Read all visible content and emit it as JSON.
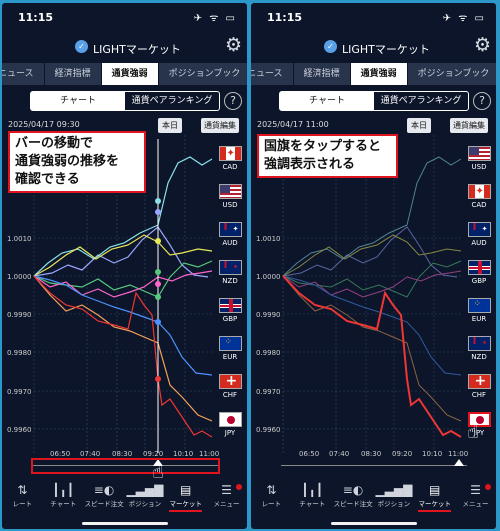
{
  "colors": {
    "usd": "#ff66cc",
    "cad": "#4c93ff",
    "aud": "#e9e75a",
    "nzd": "#58c97d",
    "gbp": "#8be0ea",
    "eur": "#9aa6ff",
    "chf": "#ef3636",
    "jpy": "#f4a259"
  },
  "left": {
    "status": {
      "time": "11:15",
      "icons": "✈ ᯤ ▭"
    },
    "header": {
      "title": "LIGHTマーケット"
    },
    "tabs": [
      "ニュース",
      "経済指標",
      "通貨強弱",
      "ポジションブック"
    ],
    "segment": [
      "チャート",
      "通貨ペアランキング"
    ],
    "help": "?",
    "datetime": "2025/04/17 09:30",
    "buttons": {
      "today": "本日",
      "edit": "通貨編集"
    },
    "annotation": [
      "バーの移動で",
      "通貨強弱の推移を",
      "確認できる"
    ],
    "flags": [
      "CAD",
      "USD",
      "AUD",
      "NZD",
      "GBP",
      "EUR",
      "CHF",
      "JPY"
    ],
    "yticks": [
      "1.0010",
      "1.0000",
      "0.9990",
      "0.9980",
      "0.9970",
      "0.9960"
    ],
    "xticks": [
      "06:50",
      "07:40",
      "08:30",
      "09:20",
      "10:10",
      "11:00"
    ]
  },
  "right": {
    "status": {
      "time": "11:15",
      "icons": "✈ ᯤ ▭"
    },
    "header": {
      "title": "LIGHTマーケット"
    },
    "tabs": [
      "ニュース",
      "経済指標",
      "通貨強弱",
      "ポジションブック"
    ],
    "segment": [
      "チャート",
      "通貨ペアランキング"
    ],
    "help": "?",
    "datetime": "2025/04/17 11:00",
    "buttons": {
      "today": "本日",
      "edit": "通貨編集"
    },
    "annotation": [
      "国旗をタップすると",
      "強調表示される"
    ],
    "flags": [
      "USD",
      "CAD",
      "AUD",
      "GBP",
      "EUR",
      "NZD",
      "CHF",
      "JPY"
    ],
    "yticks": [
      "1.0010",
      "1.0000",
      "0.9990",
      "0.9980",
      "0.9970",
      "0.9960"
    ],
    "xticks": [
      "06:50",
      "07:40",
      "08:30",
      "09:20",
      "10:10",
      "11:00"
    ]
  },
  "nav": [
    "レート",
    "チャート",
    "スピード注文",
    "ポジション",
    "マーケット",
    "メニュー"
  ],
  "nav_icons": {
    "rate": "arrows-icon",
    "chart": "candle-icon",
    "speed": "speed-order-icon",
    "position": "bars-icon",
    "market": "newspaper-icon",
    "menu": "menu-icon"
  }
}
